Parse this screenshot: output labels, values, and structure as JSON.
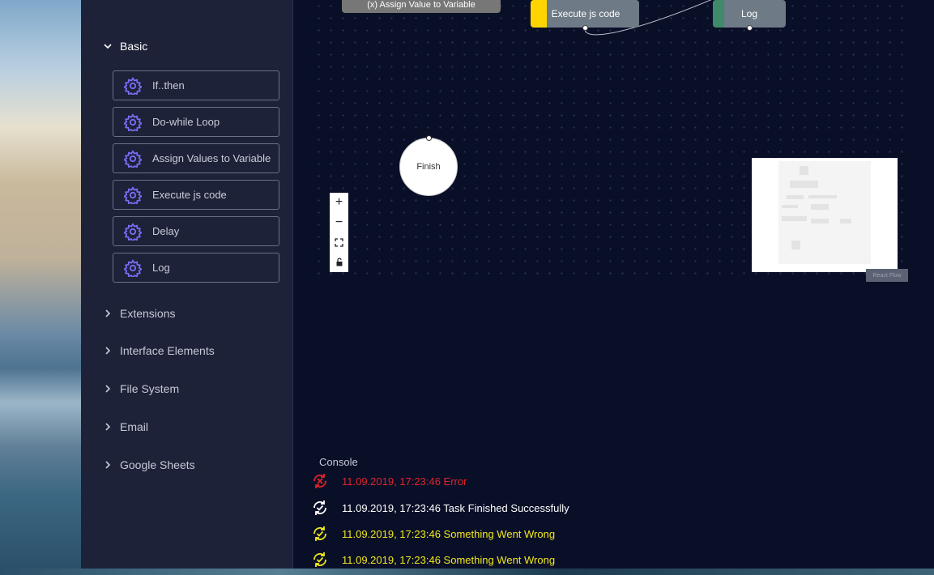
{
  "sidebar": {
    "categories": [
      {
        "label": "Basic",
        "expanded": true
      },
      {
        "label": "Extensions",
        "expanded": false
      },
      {
        "label": "Interface Elements",
        "expanded": false
      },
      {
        "label": "File System",
        "expanded": false
      },
      {
        "label": "Email",
        "expanded": false
      },
      {
        "label": "Google Sheets",
        "expanded": false
      }
    ],
    "basic_items": [
      {
        "label": "If..then",
        "icon": "gear-icon"
      },
      {
        "label": "Do-while Loop",
        "icon": "gear-icon"
      },
      {
        "label": "Assign Values to Variable",
        "icon": "gear-icon"
      },
      {
        "label": "Execute js code",
        "icon": "gear-icon"
      },
      {
        "label": "Delay",
        "icon": "gear-icon"
      },
      {
        "label": "Log",
        "icon": "gear-icon"
      }
    ]
  },
  "canvas": {
    "nodes": {
      "assign": {
        "label": "(x) Assign Value to Variable"
      },
      "execute": {
        "label": "Execute js code",
        "color": "#ffd400"
      },
      "log": {
        "label": "Log",
        "color": "#3f8a6a"
      },
      "finish": {
        "label": "Finish"
      }
    },
    "zoom_controls": {
      "zoom_in": "+",
      "zoom_out": "−"
    },
    "minimap_label": "React Flow"
  },
  "console": {
    "title": "Console",
    "entries": [
      {
        "text": "11.09.2019, 17:23:46 Error",
        "status": "error",
        "color": "#e0242b"
      },
      {
        "text": "11.09.2019, 17:23:46 Task Finished Successfully",
        "status": "success",
        "color": "#ffffff"
      },
      {
        "text": "11.09.2019, 17:23:46 Something Went Wrong",
        "status": "warning",
        "color": "#f2e81b"
      },
      {
        "text": "11.09.2019, 17:23:46 Something Went Wrong",
        "status": "warning",
        "color": "#f2e81b"
      }
    ]
  },
  "colors": {
    "accent_icon": "#7b6cf6",
    "background": "#0a0f28",
    "sidebar": "#1d2238"
  }
}
